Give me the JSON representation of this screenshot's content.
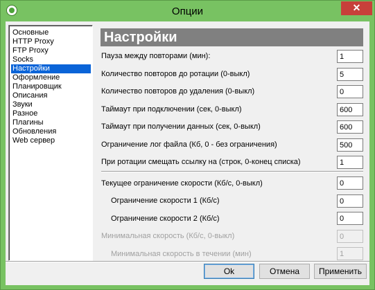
{
  "window": {
    "title": "Опции",
    "close_glyph": "✕",
    "app_icon": "app-icon"
  },
  "nav": {
    "items": [
      {
        "label": "Основные",
        "selected": false
      },
      {
        "label": "HTTP Proxy",
        "selected": false
      },
      {
        "label": "FTP Proxy",
        "selected": false
      },
      {
        "label": "Socks",
        "selected": false
      },
      {
        "label": "Настройки",
        "selected": true
      },
      {
        "label": "Оформление",
        "selected": false
      },
      {
        "label": "Планировщик",
        "selected": false
      },
      {
        "label": "Описания",
        "selected": false
      },
      {
        "label": "Звуки",
        "selected": false
      },
      {
        "label": "Разное",
        "selected": false
      },
      {
        "label": "Плагины",
        "selected": false
      },
      {
        "label": "Обновления",
        "selected": false
      },
      {
        "label": "Web сервер",
        "selected": false
      }
    ]
  },
  "settings": {
    "header": "Настройки",
    "rows": [
      {
        "label": "Пауза между повторами (мин):",
        "value": "1",
        "enabled": true
      },
      {
        "label": "Количество повторов до ротации (0-выкл)",
        "value": "5",
        "enabled": true
      },
      {
        "label": "Количество повторов до удаления (0-выкл)",
        "value": "0",
        "enabled": true
      },
      {
        "label": "Таймаут при подключении (сек, 0-выкл)",
        "value": "600",
        "enabled": true
      },
      {
        "label": "Таймаут при получении данных (сек, 0-выкл)",
        "value": "600",
        "enabled": true
      },
      {
        "label": "Ограничение лог файла (Кб, 0 - без ограничения)",
        "value": "500",
        "enabled": true
      },
      {
        "label": "При ротации смещать ссылку на (строк, 0-конец списка)",
        "value": "1",
        "enabled": true
      }
    ],
    "speed_rows": [
      {
        "label": "Текущее ограничение скорости (Кб/с, 0-выкл)",
        "value": "0",
        "enabled": true
      },
      {
        "label": "Ограничение скорости 1 (Кб/с)",
        "value": "0",
        "enabled": true
      },
      {
        "label": "Ограничение скорости 2 (Кб/с)",
        "value": "0",
        "enabled": true
      },
      {
        "label": "Минимальная  скорость (Кб/с, 0-выкл)",
        "value": "0",
        "enabled": false
      },
      {
        "label": "Минимальная скорость в течении (мин)",
        "value": "1",
        "enabled": false
      }
    ]
  },
  "buttons": {
    "ok": "Ok",
    "cancel": "Отмена",
    "apply": "Применить"
  },
  "colors": {
    "title_bar": "#78c262",
    "selection": "#0a64d8",
    "header_bg": "#808080",
    "close": "#c7403a"
  }
}
